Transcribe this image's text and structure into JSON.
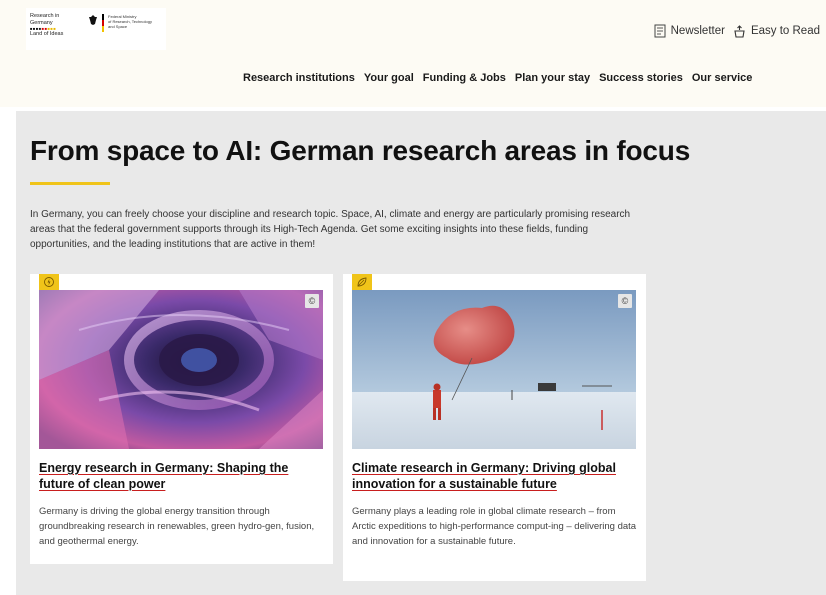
{
  "header": {
    "logo_rig_lines": [
      "Research in",
      "Germany",
      "Land of Ideas"
    ],
    "logo_ministry_lines": [
      "Federal Ministry",
      "of Research, Technology",
      "and Space"
    ],
    "newsletter_label": "Newsletter",
    "easy_read_label": "Easy to Read"
  },
  "nav": {
    "items": [
      "Research institutions",
      "Your goal",
      "Funding & Jobs",
      "Plan your stay",
      "Success stories",
      "Our service"
    ]
  },
  "main": {
    "title": "From space to AI: German research areas in focus",
    "intro": "In Germany, you can freely choose your discipline and research topic. Space, AI, climate and energy are particularly promising research areas that the federal government supports through its High-Tech Agenda. Get some exciting insights into these fields, funding opportunities, and the leading institutions that are active in them!",
    "cards": [
      {
        "icon": "energy-icon",
        "copyright": "©",
        "title": "Energy research in Germany: Shaping the future of clean power",
        "text": "Germany is driving the global energy transition through groundbreaking research in renewables, green hydro-gen, fusion, and geothermal energy."
      },
      {
        "icon": "leaf-icon",
        "copyright": "©",
        "title": "Climate research in Germany: Driving global innovation for a sustainable future",
        "text": "Germany plays a leading role in global climate research – from Arctic expeditions to high-performance comput-ing – delivering data and innovation for a sustainable future."
      }
    ]
  },
  "colors": {
    "accent_yellow": "#f0c419",
    "link_underline_red": "#c81e1e",
    "header_bg": "#fdfbf4",
    "main_bg": "#e9e9e9"
  }
}
